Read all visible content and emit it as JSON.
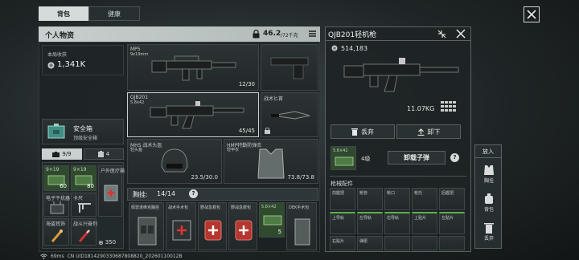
{
  "tabs": [
    {
      "label": "背包",
      "active": true
    },
    {
      "label": "健康",
      "active": false
    }
  ],
  "personal": {
    "title": "个人物资",
    "weight": "46.2",
    "weight_max": "/72千克",
    "income_label": "本局收获",
    "income_value": "1,341K",
    "safebox_title": "安全箱",
    "safebox_sub": "顶级安全箱",
    "pocket_tab1": "9/9",
    "pocket_tab2": "4",
    "pocket_items": [
      {
        "name": "9×19",
        "count": "60"
      },
      {
        "name": "9×19",
        "count": "80"
      },
      {
        "name": "户外医疗箱",
        "count": ""
      },
      {
        "name": "电子干扰器",
        "count": ""
      },
      {
        "name": "卡尺",
        "count": ""
      },
      {
        "name": "海盗耳饰",
        "count": ""
      },
      {
        "name": "战斗兴奋剂",
        "count": ""
      }
    ],
    "extra_count": "350"
  },
  "weapons": {
    "primary": {
      "name": "MP5",
      "sub": "9x19mm",
      "ammo": "12/30"
    },
    "secondary": {
      "name": "QJB201",
      "sub": "5.8x42",
      "ammo": "45/45"
    },
    "knife": {
      "name": "战术匕首"
    },
    "helmet": {
      "name": "MHS 战术头盔",
      "sub": "轻头盔",
      "dur": "23.5/30.0"
    },
    "armor": {
      "name": "HMP特勤防弹衣",
      "sub": "轻甲衣",
      "dur": "73.8/73.8"
    }
  },
  "rig": {
    "title": "胸挂:",
    "count": "14/14",
    "help": "?",
    "items": [
      {
        "name": "佩雷诺维克胸挂"
      },
      {
        "name": "战术手术包"
      },
      {
        "name": "野战急救包"
      },
      {
        "name": "野战急救包"
      },
      {
        "name": "5.8×42",
        "count": "5"
      },
      {
        "name": "DEK手术包"
      }
    ]
  },
  "detail": {
    "title": "QJB201轻机枪",
    "price": "514,183",
    "weight": "11.07KG",
    "discard": "丢弃",
    "unload": "卸下",
    "ammo_name": "5.8×42",
    "ammo_grade": "4级",
    "unload_ammo": "卸载子弹",
    "help": "?",
    "attach_title": "枪械配件",
    "attachments_row1": [
      "前握把",
      "枪管",
      "枪口",
      "枪托",
      "后握把"
    ],
    "attachments_row2": [
      "上导轨",
      "左导轨",
      "右导轨",
      "上贴片",
      "左贴片"
    ],
    "attachments_row3": [
      "右贴片",
      "弹匣",
      "",
      "",
      ""
    ]
  },
  "side": {
    "title": "放入",
    "items": [
      {
        "label": "胸挂"
      },
      {
        "label": "背包"
      },
      {
        "label": "丢弃"
      }
    ]
  },
  "footer": {
    "ping": "69ms",
    "uid": "CN UID1814290330687808820_20260110012B"
  }
}
